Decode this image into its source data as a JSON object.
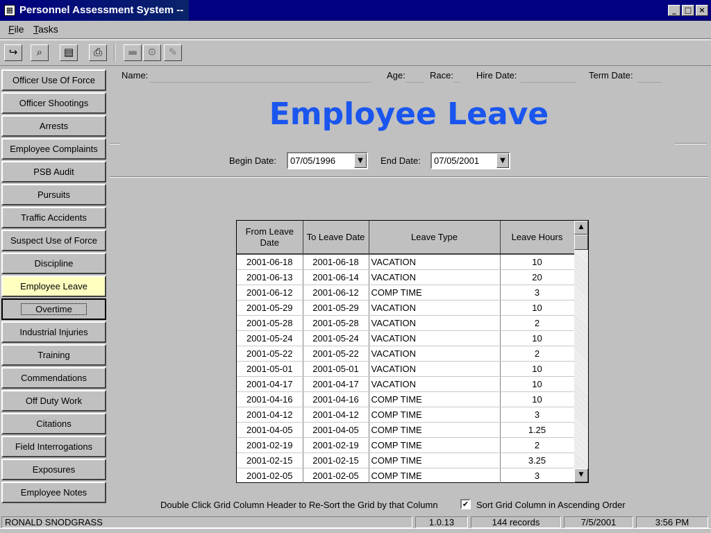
{
  "window": {
    "title": "Personnel Assessment System --",
    "minimize": "_",
    "maximize": "□",
    "close": "×"
  },
  "menu": {
    "file": {
      "hotkey": "F",
      "rest": "ile"
    },
    "tasks": {
      "hotkey": "T",
      "rest": "asks"
    }
  },
  "toolbar": {
    "buttons": [
      {
        "icon": "exit-door-icon",
        "glyph": "↪"
      },
      {
        "icon": "binoculars-icon",
        "glyph": "⌕"
      },
      {
        "icon": "book-icon",
        "glyph": "▤"
      },
      {
        "icon": "printer-icon",
        "glyph": "⎙"
      },
      {
        "icon": "save-icon",
        "glyph": "▬"
      },
      {
        "icon": "tools-icon",
        "glyph": "⚙"
      },
      {
        "icon": "pencil-icon",
        "glyph": "✎"
      }
    ]
  },
  "sidebar": {
    "items": [
      {
        "label": "Officer Use Of Force"
      },
      {
        "label": "Officer Shootings"
      },
      {
        "label": "Arrests"
      },
      {
        "label": "Employee Complaints"
      },
      {
        "label": "PSB Audit"
      },
      {
        "label": "Pursuits"
      },
      {
        "label": "Traffic Accidents"
      },
      {
        "label": "Suspect Use of Force"
      },
      {
        "label": "Discipline"
      },
      {
        "label": "Employee Leave"
      },
      {
        "label": "Overtime"
      },
      {
        "label": "Industrial Injuries"
      },
      {
        "label": "Training"
      },
      {
        "label": "Commendations"
      },
      {
        "label": "Off Duty Work"
      },
      {
        "label": "Citations"
      },
      {
        "label": "Field Interrogations"
      },
      {
        "label": "Exposures"
      },
      {
        "label": "Employee Notes"
      }
    ],
    "active_index": 9,
    "focused_index": 10
  },
  "header": {
    "name_label": "Name:",
    "age_label": "Age:",
    "race_label": "Race:",
    "hire_label": "Hire Date:",
    "term_label": "Term Date:",
    "page_title": "Employee Leave"
  },
  "filters": {
    "begin_label": "Begin Date:",
    "begin_value": "07/05/1996",
    "end_label": "End Date:",
    "end_value": "07/05/2001",
    "dropdown_glyph": "▼"
  },
  "grid": {
    "columns": [
      {
        "label": "From Leave Date"
      },
      {
        "label": "To Leave Date"
      },
      {
        "label": "Leave Type"
      },
      {
        "label": "Leave Hours"
      }
    ],
    "rows": [
      [
        "2001-06-18",
        "2001-06-18",
        "VACATION",
        "10"
      ],
      [
        "2001-06-13",
        "2001-06-14",
        "VACATION",
        "20"
      ],
      [
        "2001-06-12",
        "2001-06-12",
        "COMP TIME",
        "3"
      ],
      [
        "2001-05-29",
        "2001-05-29",
        "VACATION",
        "10"
      ],
      [
        "2001-05-28",
        "2001-05-28",
        "VACATION",
        "2"
      ],
      [
        "2001-05-24",
        "2001-05-24",
        "VACATION",
        "10"
      ],
      [
        "2001-05-22",
        "2001-05-22",
        "VACATION",
        "2"
      ],
      [
        "2001-05-01",
        "2001-05-01",
        "VACATION",
        "10"
      ],
      [
        "2001-04-17",
        "2001-04-17",
        "VACATION",
        "10"
      ],
      [
        "2001-04-16",
        "2001-04-16",
        "COMP TIME",
        "10"
      ],
      [
        "2001-04-12",
        "2001-04-12",
        "COMP TIME",
        "3"
      ],
      [
        "2001-04-05",
        "2001-04-05",
        "COMP TIME",
        "1.25"
      ],
      [
        "2001-02-19",
        "2001-02-19",
        "COMP TIME",
        "2"
      ],
      [
        "2001-02-15",
        "2001-02-15",
        "COMP TIME",
        "3.25"
      ],
      [
        "2001-02-05",
        "2001-02-05",
        "COMP TIME",
        "3"
      ]
    ],
    "scroll_up": "▲",
    "scroll_down": "▼"
  },
  "footer": {
    "hint": "Double Click Grid Column Header to Re-Sort the Grid by that Column",
    "sort_checked": true,
    "check_glyph": "✔",
    "sort_label": "Sort Grid Column in Ascending Order"
  },
  "status": {
    "user": "RONALD SNODGRASS",
    "version": "1.0.13",
    "records": "144 records",
    "date": "7/5/2001",
    "time": "3:56 PM"
  },
  "colors": {
    "title_bar": "#000080",
    "page_title": "#1a55ee",
    "active_nav": "#ffffc0"
  }
}
